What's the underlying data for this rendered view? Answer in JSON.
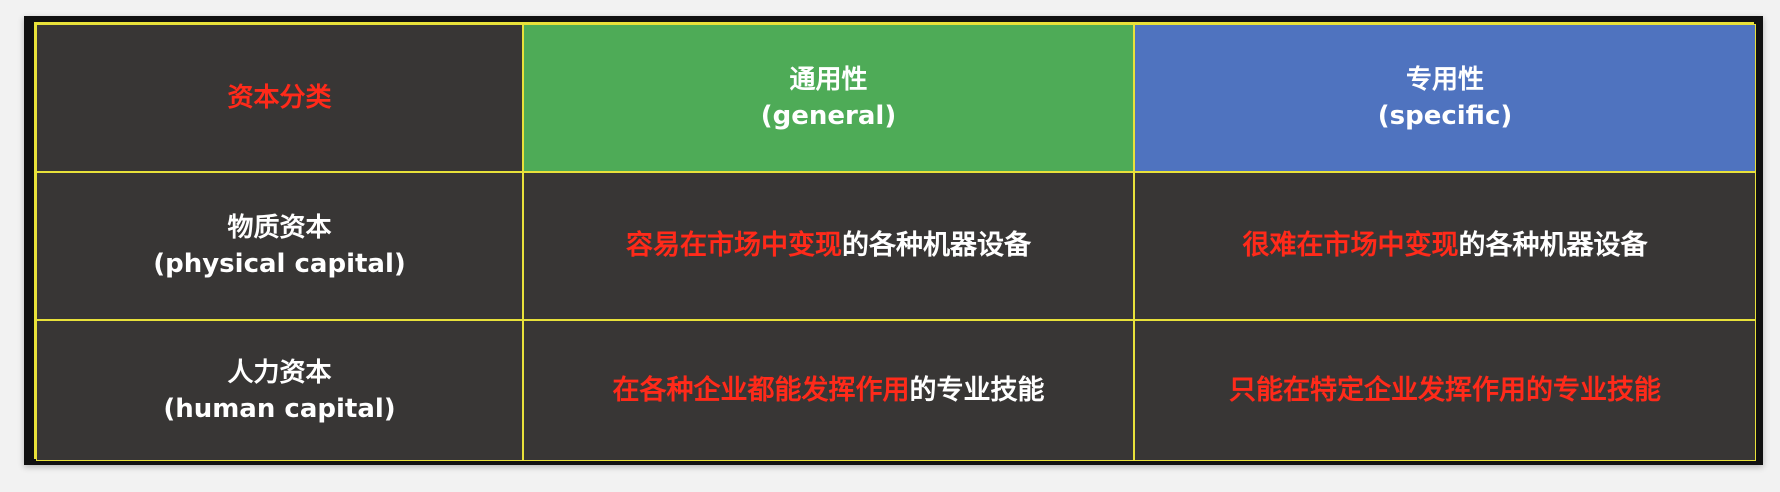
{
  "table": {
    "header": {
      "category_label": "资本分类",
      "general": {
        "cn": "通用性",
        "en": "(general)"
      },
      "specific": {
        "cn": "专用性",
        "en": "(specific)"
      }
    },
    "rows": [
      {
        "label_cn": "物质资本",
        "label_en": "(physical capital)",
        "general": {
          "highlight": "容易在市场中变现",
          "rest": "的各种机器设备"
        },
        "specific": {
          "highlight": "很难在市场中变现",
          "rest": "的各种机器设备"
        }
      },
      {
        "label_cn": "人力资本",
        "label_en": "(human capital)",
        "general": {
          "highlight": "在各种企业都能发挥作用",
          "rest": "的专业技能"
        },
        "specific": {
          "highlight": "只能在特定企业发挥作用的专业技能",
          "rest": ""
        }
      }
    ]
  },
  "colors": {
    "header_general_bg": "#4eab57",
    "header_specific_bg": "#4f73bf",
    "cell_bg": "#383635",
    "border": "#e8e13a",
    "highlight_text": "#ff2a1a",
    "normal_text": "#ffffff"
  }
}
